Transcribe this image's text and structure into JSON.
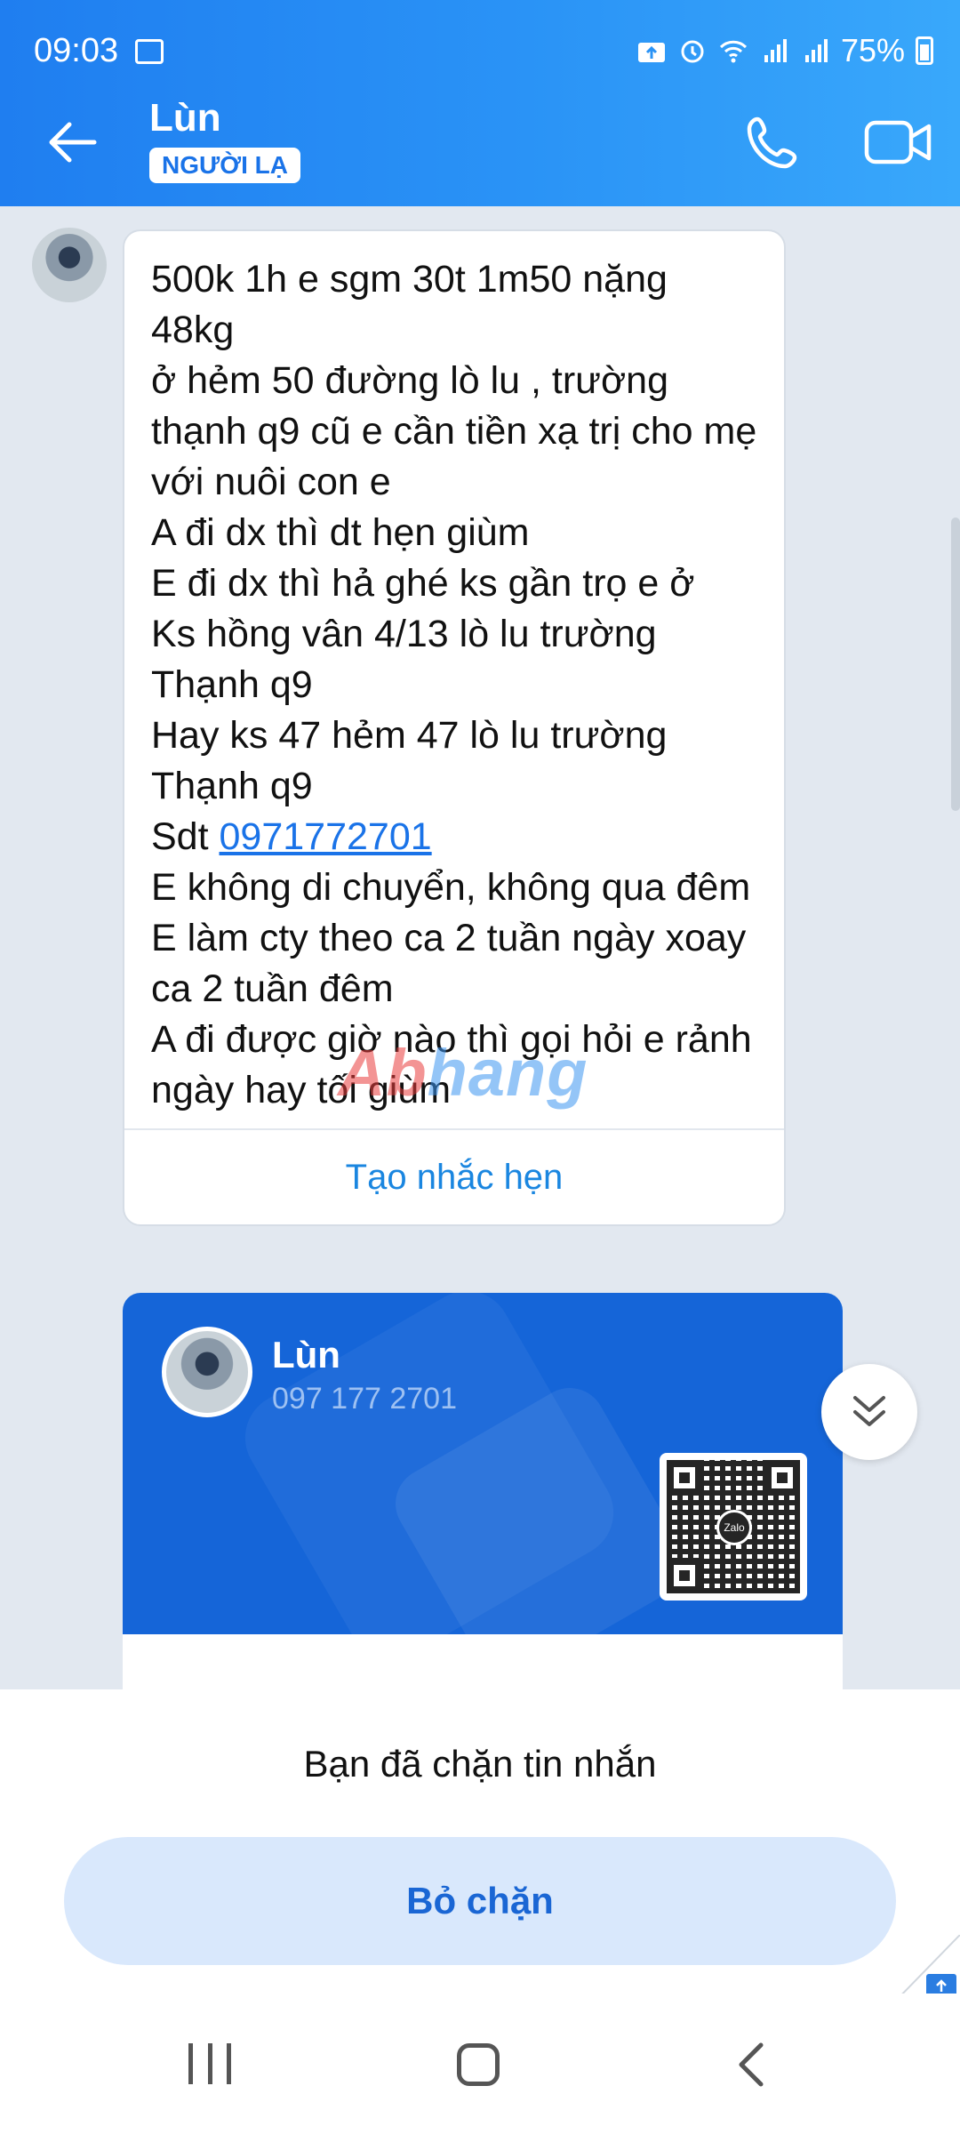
{
  "status_bar": {
    "time": "09:03",
    "battery": "75%"
  },
  "header": {
    "contact_name": "Lùn",
    "badge": "NGƯỜI LẠ"
  },
  "message": {
    "text": "500k 1h e sgm 30t 1m50 nặng 48kg\nở hẻm 50 đường lò lu , trường thạnh q9 cũ e cần tiền xạ trị cho mẹ với nuôi con e\nA đi dx thì dt hẹn giùm\nE đi dx thì hả ghé ks gần trọ e ở\nKs hồng vân 4/13 lò lu trường Thạnh q9\nHay ks 47 hẻm 47 lò lu trường Thạnh q9\nSdt ",
    "phone_link": "0971772701",
    "text_after": "\nE không di chuyển, không qua đêm\nE làm cty theo ca 2 tuần ngày xoay ca 2 tuần đêm\nA đi được giờ nào thì gọi hỏi e rảnh ngày hay tối giùm",
    "reminder_action": "Tạo nhắc hẹn"
  },
  "contact_card": {
    "name": "Lùn",
    "phone": "097 177 2701",
    "qr_logo": "Zalo"
  },
  "watermark": {
    "part1": "Ab",
    "part2": "hang"
  },
  "blocked": {
    "message": "Bạn đã chặn tin nhắn",
    "unblock_label": "Bỏ chặn"
  },
  "icons": {
    "back": "arrow-left-icon",
    "call": "phone-icon",
    "video": "video-camera-icon",
    "scroll_down": "double-chevron-down-icon"
  },
  "colors": {
    "header_gradient_start": "#1f7ef0",
    "header_gradient_end": "#39a8fb",
    "accent": "#1a73e8",
    "card_bg": "#1565d8",
    "unblock_bg": "#d9e8fc"
  }
}
